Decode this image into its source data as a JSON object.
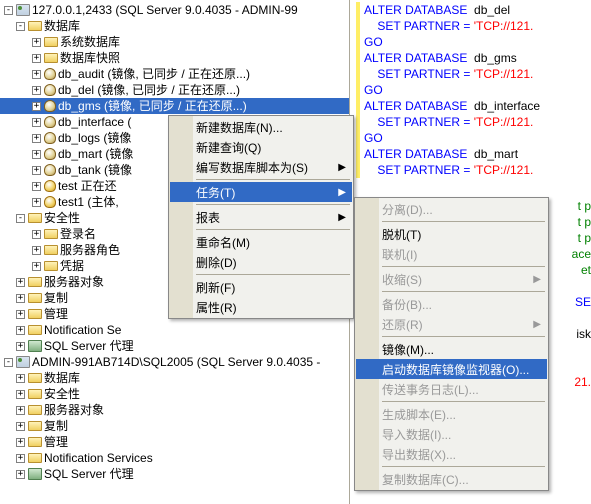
{
  "server1": {
    "label": "127.0.0.1,2433 (SQL Server 9.0.4035 - ADMIN-99",
    "db_root": "数据库",
    "sys_db": "系统数据库",
    "snapshot": "数据库快照",
    "dbs": {
      "audit": "db_audit (镜像, 已同步 / 正在还原...)",
      "del": "db_del (镜像, 已同步 / 正在还原...)",
      "gms": "db_gms (镜像, 已同步 / 正在还原...)",
      "interface": "db_interface (",
      "logs": "db_logs (镜像",
      "mart": "db_mart (镜像",
      "tank": "db_tank (镜像",
      "test_restore": "test 正在还",
      "test1": "test1 (主体,"
    },
    "security": "安全性",
    "logins": "登录名",
    "server_roles": "服务器角色",
    "credentials": "凭据",
    "server_objects": "服务器对象",
    "replication": "复制",
    "management": "管理",
    "notification": "Notification Se",
    "agent": "SQL Server 代理"
  },
  "server2": {
    "label": "ADMIN-991AB714D\\SQL2005 (SQL Server 9.0.4035 -",
    "db": "数据库",
    "security": "安全性",
    "server_objects": "服务器对象",
    "replication": "复制",
    "management": "管理",
    "notification": "Notification Services",
    "agent": "SQL Server 代理"
  },
  "menu1": {
    "new_db": "新建数据库(N)...",
    "new_query": "新建查询(Q)",
    "script_db": "编写数据库脚本为(S)",
    "tasks": "任务(T)",
    "reports": "报表",
    "rename": "重命名(M)",
    "delete": "删除(D)",
    "refresh": "刷新(F)",
    "properties": "属性(R)"
  },
  "menu2": {
    "detach": "分离(D)...",
    "offline": "脱机(T)",
    "online": "联机(I)",
    "shrink": "收缩(S)",
    "backup": "备份(B)...",
    "restore": "还原(R)",
    "mirror": "镜像(M)...",
    "monitor": "启动数据库镜像监视器(O)...",
    "ship_log": "传送事务日志(L)...",
    "gen_script": "生成脚本(E)...",
    "import": "导入数据(I)...",
    "export": "导出数据(X)...",
    "copy_db": "复制数据库(C)..."
  },
  "sql": {
    "alter": "ALTER DATABASE",
    "set_partner": "SET PARTNER =",
    "go": "GO",
    "db_del": "db_del",
    "db_gms": "db_gms",
    "db_interface": "db_interface",
    "db_mart": "db_mart",
    "tcp": "'TCP://121.",
    "frag_tp": "t p",
    "frag_ace": "ace",
    "frag_et": "et",
    "frag_se": "SE",
    "frag_isk": "isk",
    "frag_21": "21."
  }
}
